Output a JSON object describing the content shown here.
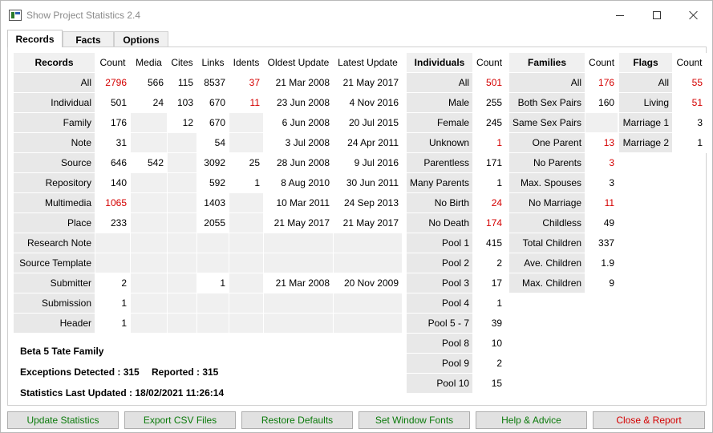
{
  "window": {
    "title": "Show Project Statistics 2.4"
  },
  "tabs": [
    {
      "label": "Records",
      "active": true
    },
    {
      "label": "Facts",
      "active": false
    },
    {
      "label": "Options",
      "active": false
    }
  ],
  "records_table": {
    "headers": [
      "Records",
      "Count",
      "Media",
      "Cites",
      "Links",
      "Idents",
      "Oldest Update",
      "Latest Update"
    ],
    "rows": [
      {
        "label": "All",
        "count": "2796",
        "media": "566",
        "cites": "115",
        "links": "8537",
        "idents": "37",
        "oldest": "21 Mar 2008",
        "latest": "21 May 2017"
      },
      {
        "label": "Individual",
        "count": "501",
        "media": "24",
        "cites": "103",
        "links": "670",
        "idents": "11",
        "oldest": "23 Jun 2008",
        "latest": "4 Nov 2016"
      },
      {
        "label": "Family",
        "count": "176",
        "media": "",
        "cites": "12",
        "links": "670",
        "idents": "",
        "oldest": "6 Jun 2008",
        "latest": "20 Jul 2015"
      },
      {
        "label": "Note",
        "count": "31",
        "media": "",
        "cites": "",
        "links": "54",
        "idents": "",
        "oldest": "3 Jul 2008",
        "latest": "24 Apr 2011"
      },
      {
        "label": "Source",
        "count": "646",
        "media": "542",
        "cites": "",
        "links": "3092",
        "idents": "25",
        "oldest": "28 Jun 2008",
        "latest": "9 Jul 2016"
      },
      {
        "label": "Repository",
        "count": "140",
        "media": "",
        "cites": "",
        "links": "592",
        "idents": "1",
        "oldest": "8 Aug 2010",
        "latest": "30 Jun 2011"
      },
      {
        "label": "Multimedia",
        "count": "1065",
        "media": "",
        "cites": "",
        "links": "1403",
        "idents": "",
        "oldest": "10 Mar 2011",
        "latest": "24 Sep 2013"
      },
      {
        "label": "Place",
        "count": "233",
        "media": "",
        "cites": "",
        "links": "2055",
        "idents": "",
        "oldest": "21 May 2017",
        "latest": "21 May 2017"
      },
      {
        "label": "Research Note",
        "count": "",
        "media": "",
        "cites": "",
        "links": "",
        "idents": "",
        "oldest": "",
        "latest": ""
      },
      {
        "label": "Source Template",
        "count": "",
        "media": "",
        "cites": "",
        "links": "",
        "idents": "",
        "oldest": "",
        "latest": ""
      },
      {
        "label": "Submitter",
        "count": "2",
        "media": "",
        "cites": "",
        "links": "1",
        "idents": "",
        "oldest": "21 Mar 2008",
        "latest": "20 Nov 2009"
      },
      {
        "label": "Submission",
        "count": "1",
        "media": "",
        "cites": "",
        "links": "",
        "idents": "",
        "oldest": "",
        "latest": ""
      },
      {
        "label": "Header",
        "count": "1",
        "media": "",
        "cites": "",
        "links": "",
        "idents": "",
        "oldest": "",
        "latest": ""
      }
    ]
  },
  "individuals_table": {
    "headers": [
      "Individuals",
      "Count"
    ],
    "rows": [
      {
        "label": "All",
        "count": "501"
      },
      {
        "label": "Male",
        "count": "255"
      },
      {
        "label": "Female",
        "count": "245"
      },
      {
        "label": "Unknown",
        "count": "1"
      },
      {
        "label": "Parentless",
        "count": "171"
      },
      {
        "label": "Many Parents",
        "count": "1"
      },
      {
        "label": "No Birth",
        "count": "24"
      },
      {
        "label": "No Death",
        "count": "174"
      },
      {
        "label": "Pool 1",
        "count": "415"
      },
      {
        "label": "Pool 2",
        "count": "2"
      },
      {
        "label": "Pool 3",
        "count": "17"
      },
      {
        "label": "Pool 4",
        "count": "1"
      },
      {
        "label": "Pool 5 - 7",
        "count": "39"
      },
      {
        "label": "Pool 8",
        "count": "10"
      },
      {
        "label": "Pool 9",
        "count": "2"
      },
      {
        "label": "Pool 10",
        "count": "15"
      }
    ]
  },
  "families_table": {
    "headers": [
      "Families",
      "Count"
    ],
    "rows": [
      {
        "label": "All",
        "count": "176"
      },
      {
        "label": "Both Sex Pairs",
        "count": "160"
      },
      {
        "label": "Same Sex Pairs",
        "count": ""
      },
      {
        "label": "One Parent",
        "count": "13"
      },
      {
        "label": "No Parents",
        "count": "3"
      },
      {
        "label": "Max. Spouses",
        "count": "3"
      },
      {
        "label": "No Marriage",
        "count": "11"
      },
      {
        "label": "Childless",
        "count": "49"
      },
      {
        "label": "Total Children",
        "count": "337"
      },
      {
        "label": "Ave. Children",
        "count": "1.9"
      },
      {
        "label": "Max. Children",
        "count": "9"
      }
    ]
  },
  "flags_table": {
    "headers": [
      "Flags",
      "Count"
    ],
    "rows": [
      {
        "label": "All",
        "count": "55"
      },
      {
        "label": "Living",
        "count": "51"
      },
      {
        "label": "Marriage 1",
        "count": "3"
      },
      {
        "label": "Marriage 2",
        "count": "1"
      }
    ]
  },
  "summary": {
    "project_name": "Beta 5 Tate Family",
    "exceptions_label": "Exceptions Detected : 315",
    "reported_label": "Reported : 315",
    "last_updated_label": "Statistics Last Updated : 18/02/2021 11:26:14"
  },
  "buttons": {
    "update": "Update Statistics",
    "export": "Export CSV Files",
    "restore": "Restore Defaults",
    "fonts": "Set Window Fonts",
    "help": "Help & Advice",
    "close": "Close & Report"
  },
  "colors": {
    "exception_red": "#d40000",
    "button_green": "#0a7a0a",
    "label_gray": "#e8e8e8"
  }
}
